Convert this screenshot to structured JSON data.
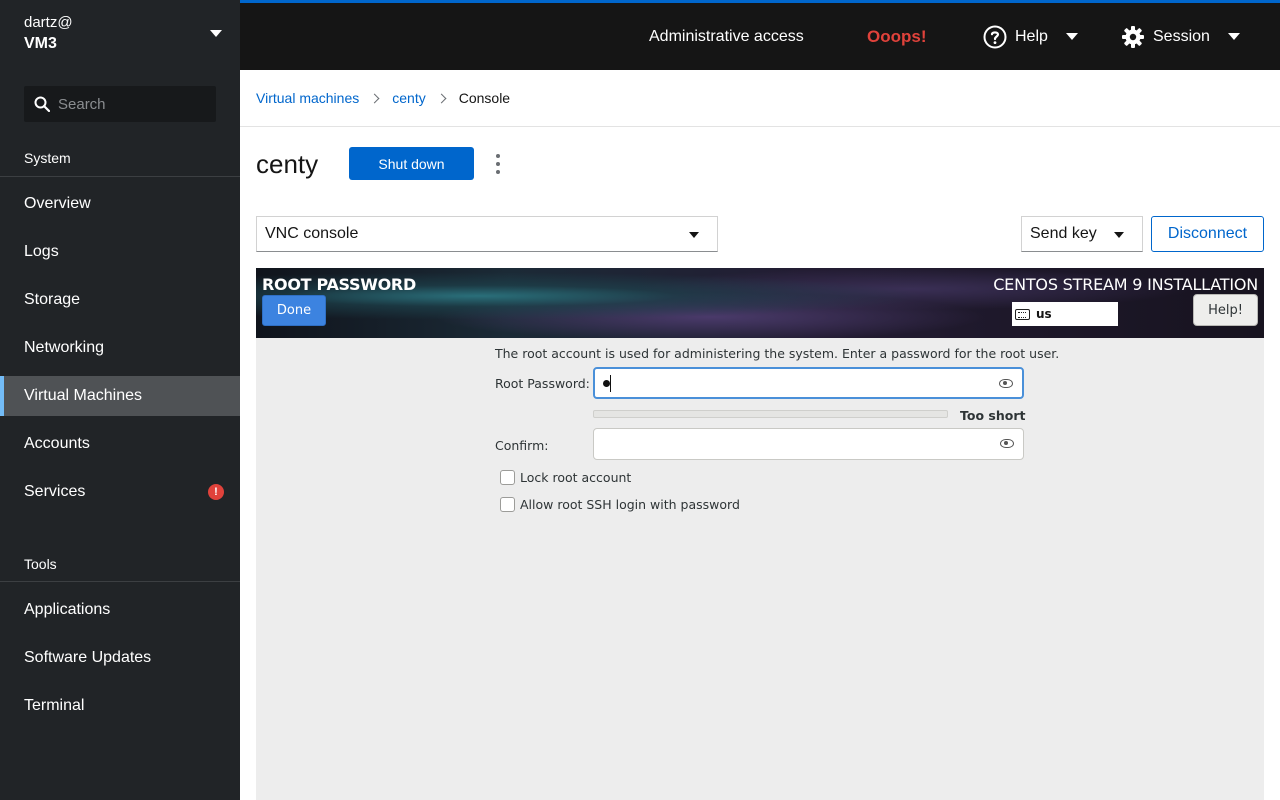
{
  "host": {
    "user": "dartz@",
    "name": "VM3"
  },
  "search": {
    "placeholder": "Search"
  },
  "sidebar": {
    "system_label": "System",
    "tools_label": "Tools",
    "system_items": [
      {
        "label": "Overview"
      },
      {
        "label": "Logs"
      },
      {
        "label": "Storage"
      },
      {
        "label": "Networking"
      },
      {
        "label": "Virtual Machines",
        "active": true
      },
      {
        "label": "Accounts"
      },
      {
        "label": "Services",
        "badge": "!"
      }
    ],
    "tool_items": [
      {
        "label": "Applications"
      },
      {
        "label": "Software Updates"
      },
      {
        "label": "Terminal"
      }
    ]
  },
  "topbar": {
    "admin": "Administrative access",
    "oops": "Ooops!",
    "help": "Help",
    "session": "Session"
  },
  "breadcrumb": [
    "Virtual machines",
    "centy",
    "Console"
  ],
  "vm": {
    "name": "centy",
    "shutdown_label": "Shut down",
    "console_type": "VNC console",
    "sendkey_label": "Send key",
    "disconnect_label": "Disconnect"
  },
  "installer": {
    "title": "ROOT PASSWORD",
    "done_label": "Done",
    "product": "CENTOS STREAM 9 INSTALLATION",
    "keyboard_layout": "us",
    "help_label": "Help!",
    "intro": "The root account is used for administering the system.  Enter a password for the root user.",
    "root_password_label": "Root Password:",
    "strength_text": "Too short",
    "confirm_label": "Confirm:",
    "lock_root_label": "Lock root account",
    "ssh_label": "Allow root SSH login with password"
  },
  "colors": {
    "accent": "#0066cc",
    "sidebar_bg": "#212427",
    "topbar_bg": "#151515",
    "error": "#e0423b"
  }
}
